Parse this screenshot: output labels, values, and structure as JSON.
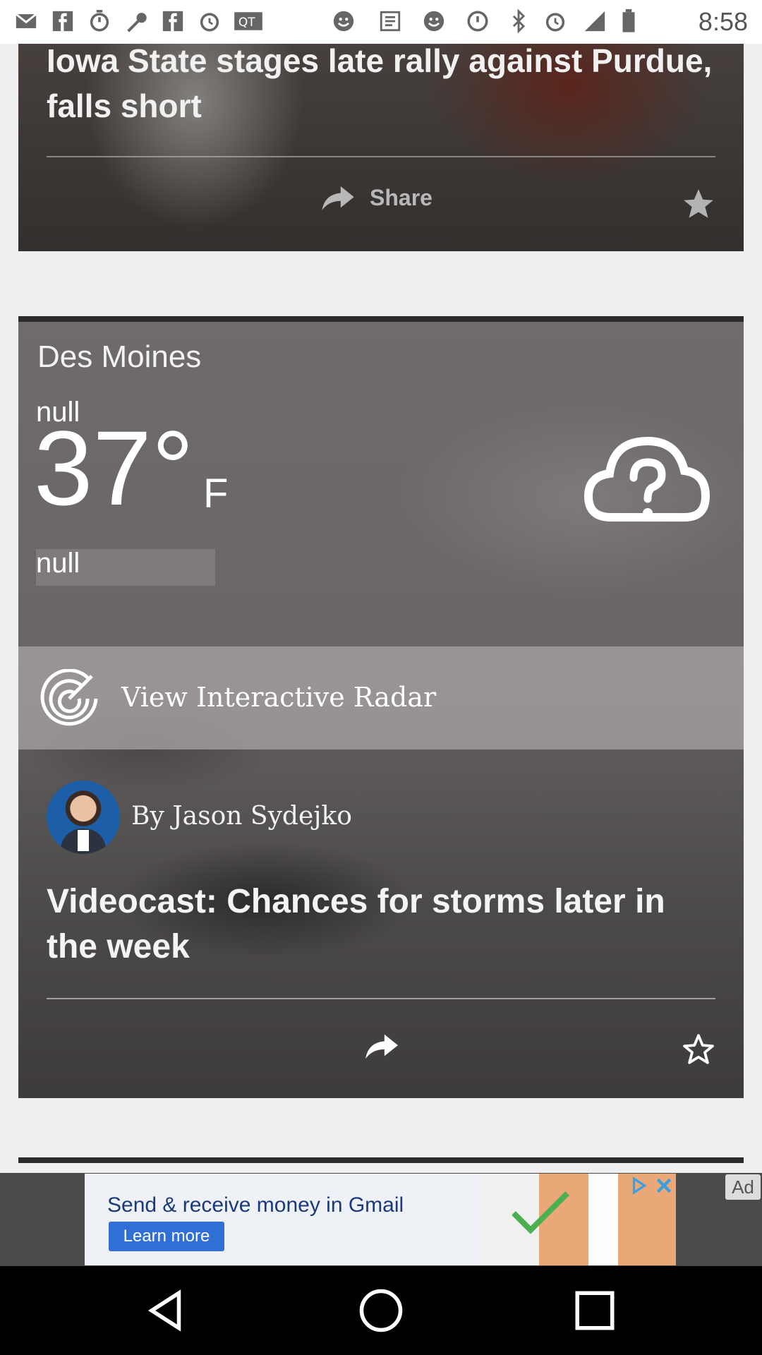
{
  "status_bar": {
    "time": "8:58",
    "icons": [
      "mail-icon",
      "facebook-icon",
      "timer-icon",
      "wrench-icon",
      "facebook-icon",
      "alarm-icon",
      "qt-icon",
      "smiley-icon",
      "app-icon",
      "smiley-icon",
      "data-saver-icon",
      "bluetooth-icon",
      "alarm-icon",
      "signal-icon",
      "battery-icon"
    ]
  },
  "card1": {
    "title": "Iowa State stages late rally against Purdue, falls short",
    "share_label": "Share"
  },
  "weather": {
    "city": "Des Moines",
    "condition_top": "null",
    "temperature": "37°",
    "unit": "F",
    "condition": "null",
    "radar_label": "View Interactive Radar"
  },
  "videocast": {
    "author": "By Jason Sydejko",
    "title": "Videocast: Chances for storms later in the week"
  },
  "ad": {
    "headline": "Send & receive money in Gmail",
    "button": "Learn more",
    "label": "Ad"
  },
  "nav": {
    "back": "back-icon",
    "home": "home-icon",
    "recents": "recents-icon"
  },
  "colors": {
    "card_text": "#f1f1f1",
    "ad_button": "#2f6fd6"
  }
}
